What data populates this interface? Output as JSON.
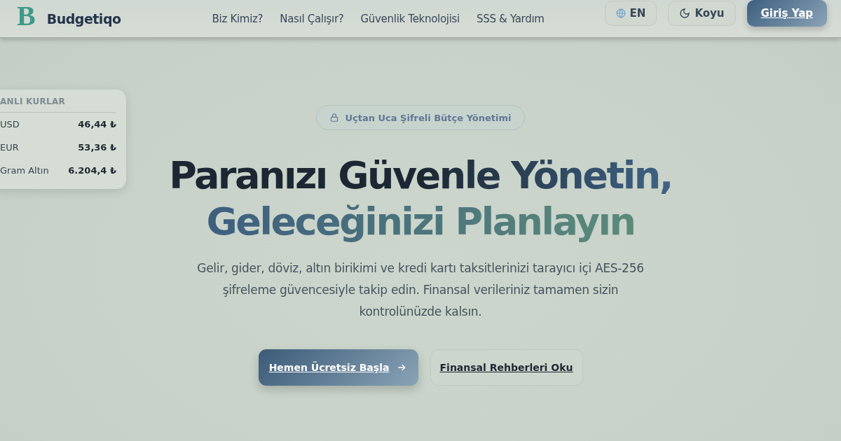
{
  "brand": {
    "name": "Budgetiqo",
    "logo_letter": "B"
  },
  "nav": [
    "Biz Kimiz?",
    "Nasıl Çalışır?",
    "Güvenlik Teknolojisi",
    "SSS & Yardım"
  ],
  "language_button": "EN",
  "theme_button": "Koyu",
  "login_button": "Giriş Yap",
  "rates_card": {
    "title": "ANLI KURLAR",
    "rows": [
      {
        "label": "USD",
        "value": "46,44 ₺"
      },
      {
        "label": "EUR",
        "value": "53,36 ₺"
      },
      {
        "label": "Gram Altın",
        "value": "6.204,4 ₺"
      }
    ]
  },
  "badge": "Uçtan Uca Şifreli Bütçe Yönetimi",
  "headline": [
    "Paranızı Güvenle Yönetin,",
    "Geleceğinizi Planlayın"
  ],
  "description": "Gelir, gider, döviz, altın birikimi ve kredi kartı taksitlerinizi tarayıcı içi AES-256 şifreleme güvencesiyle takip edin. Finansal verileriniz tamamen sizin kontrolünüzde kalsın.",
  "primary_button": "Hemen Ücretsiz Başla",
  "secondary_button": "Finansal Rehberleri Oku"
}
